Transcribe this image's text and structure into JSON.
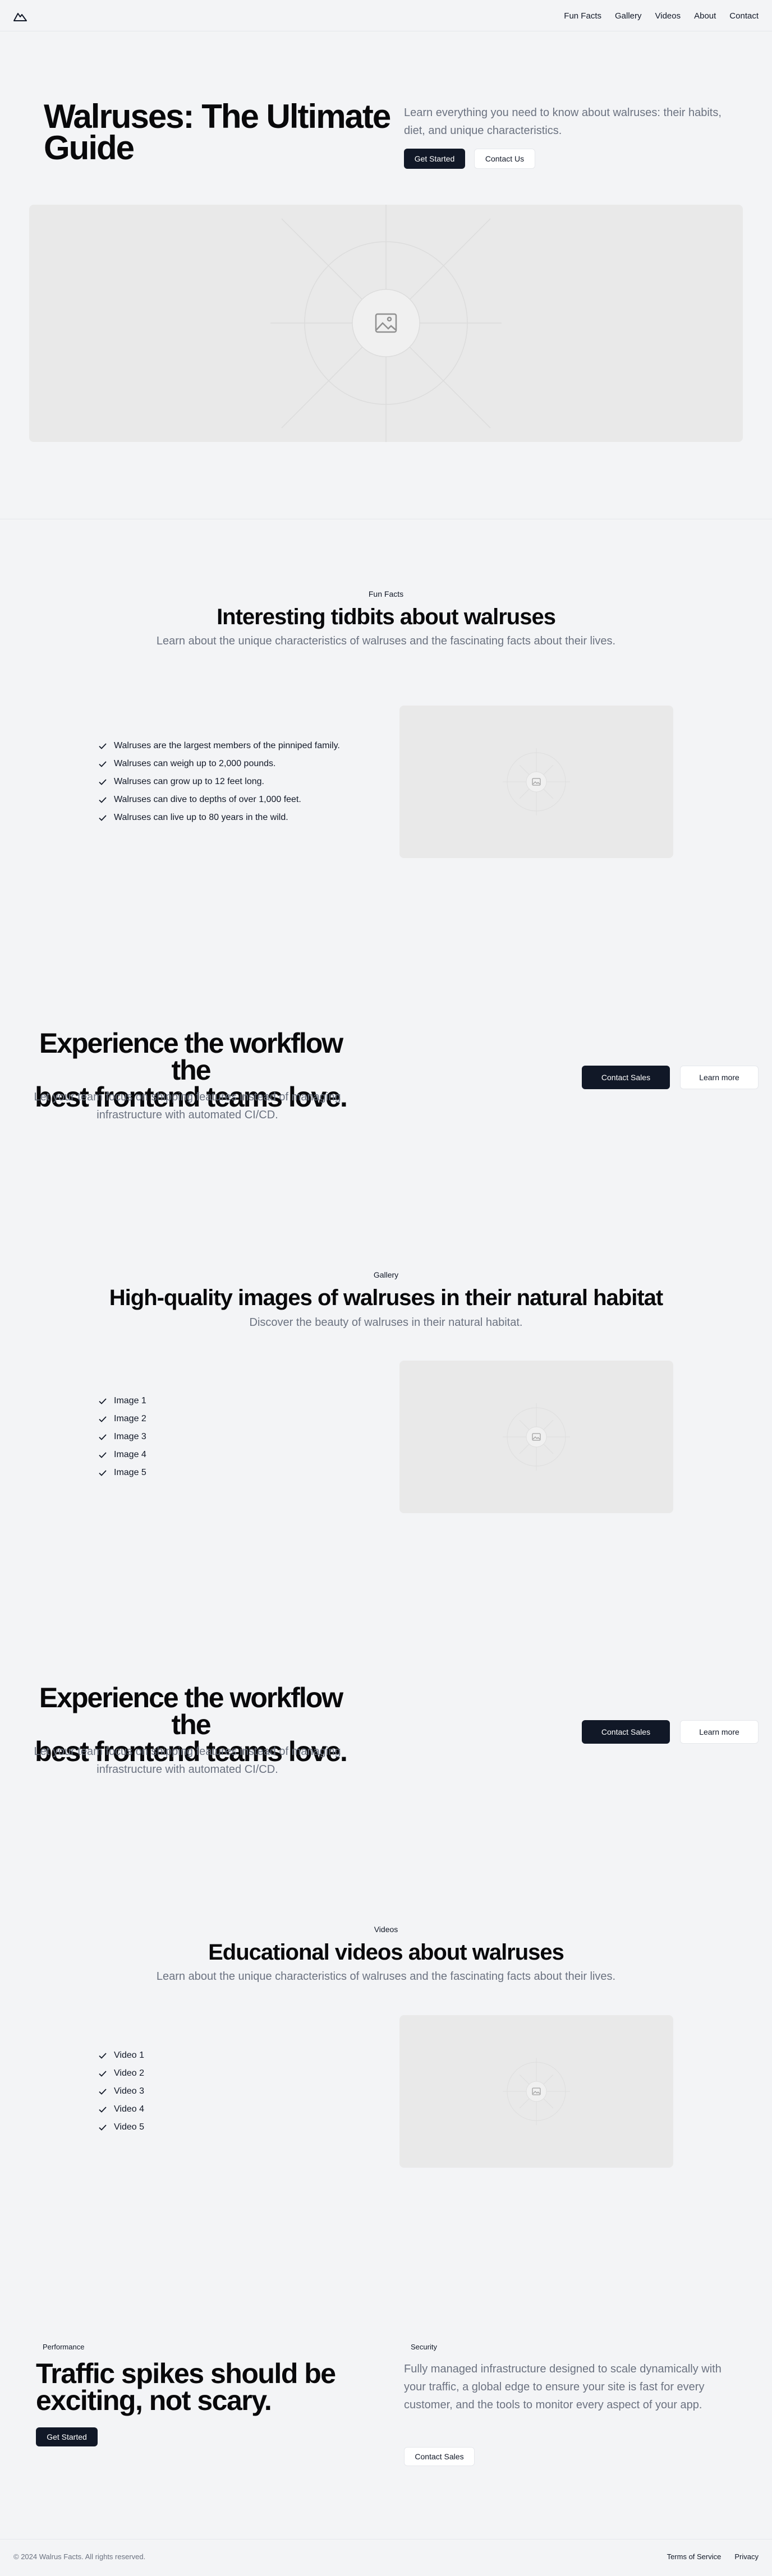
{
  "header": {
    "logo_icon": "mountain-icon",
    "nav": [
      "Fun Facts",
      "Gallery",
      "Videos",
      "About",
      "Contact"
    ]
  },
  "hero": {
    "title_line1": "Walruses: The Ultimate",
    "title_line2": "Guide",
    "subtitle": "Learn everything you need to know about walruses: their habits, diet, and unique characteristics.",
    "primary_button": "Get Started",
    "secondary_button": "Contact Us"
  },
  "fun_facts": {
    "eyebrow": "Fun Facts",
    "title": "Interesting tidbits about walruses",
    "subtitle": "Learn about the unique characteristics of walruses and the fascinating facts about their lives.",
    "items": [
      "Walruses are the largest members of the pinniped family.",
      "Walruses can weigh up to 2,000 pounds.",
      "Walruses can grow up to 12 feet long.",
      "Walruses can dive to depths of over 1,000 feet.",
      "Walruses can live up to 80 years in the wild."
    ]
  },
  "cta1": {
    "title_line1": "Experience the workflow the",
    "title_line2": "best frontend teams love.",
    "subtitle_line1": "Let your team focus on shipping features instead of managing",
    "subtitle_line2": "infrastructure with automated CI/CD.",
    "primary_button": "Contact Sales",
    "secondary_button": "Learn more"
  },
  "gallery": {
    "eyebrow": "Gallery",
    "title": "High-quality images of walruses in their natural habitat",
    "subtitle": "Discover the beauty of walruses in their natural habitat.",
    "items": [
      "Image 1",
      "Image 2",
      "Image 3",
      "Image 4",
      "Image 5"
    ]
  },
  "cta2": {
    "title_line1": "Experience the workflow the",
    "title_line2": "best frontend teams love.",
    "subtitle_line1": "Let your team focus on shipping features instead of managing",
    "subtitle_line2": "infrastructure with automated CI/CD.",
    "primary_button": "Contact Sales",
    "secondary_button": "Learn more"
  },
  "videos": {
    "eyebrow": "Videos",
    "title": "Educational videos about walruses",
    "subtitle": "Learn about the unique characteristics of walruses and the fascinating facts about their lives.",
    "items": [
      "Video 1",
      "Video 2",
      "Video 3",
      "Video 4",
      "Video 5"
    ]
  },
  "features": {
    "left_badge": "Performance",
    "left_title_line1": "Traffic spikes should be",
    "left_title_line2": "exciting, not scary.",
    "left_button": "Get Started",
    "right_badge": "Security",
    "right_text": "Fully managed infrastructure designed to scale dynamically with your traffic, a global edge to ensure your site is fast for every customer, and the tools to monitor every aspect of your app.",
    "right_button": "Contact Sales"
  },
  "footer": {
    "copyright": "© 2024 Walrus Facts. All rights reserved.",
    "links": [
      "Terms of Service",
      "Privacy"
    ]
  }
}
